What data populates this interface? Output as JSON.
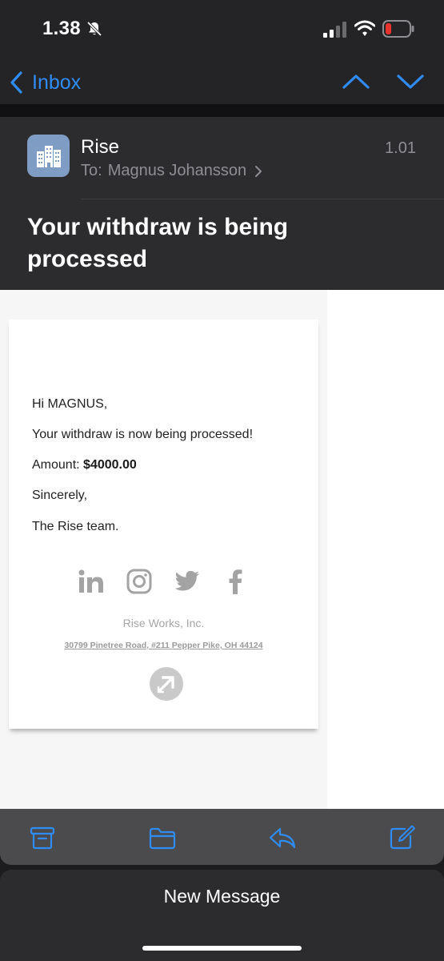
{
  "status_bar": {
    "time": "1.38"
  },
  "nav": {
    "back_label": "Inbox"
  },
  "message": {
    "sender": "Rise",
    "to_prefix": "To:",
    "recipient": "Magnus Johansson",
    "time": "1.01",
    "subject": "Your withdraw is being processed"
  },
  "email": {
    "greeting": "Hi MAGNUS,",
    "line1": "Your withdraw is now being processed!",
    "amount_label": "Amount:",
    "amount_value": "$4000.00",
    "signoff": "Sincerely,",
    "team": "The Rise team.",
    "social_icons": [
      "linkedin-icon",
      "instagram-icon",
      "twitter-icon",
      "facebook-icon"
    ],
    "company": "Rise Works, Inc.",
    "address": "30799 Pinetree Road, #211 Pepper Pike, OH 44124"
  },
  "toolbar": {
    "icons": [
      "archive-icon",
      "folder-icon",
      "reply-icon",
      "compose-icon"
    ]
  },
  "sheet": {
    "title": "New Message"
  },
  "colors": {
    "accent": "#2f8cf5",
    "battery_low": "#e8342e",
    "avatar_bg": "#7f9cc4"
  }
}
